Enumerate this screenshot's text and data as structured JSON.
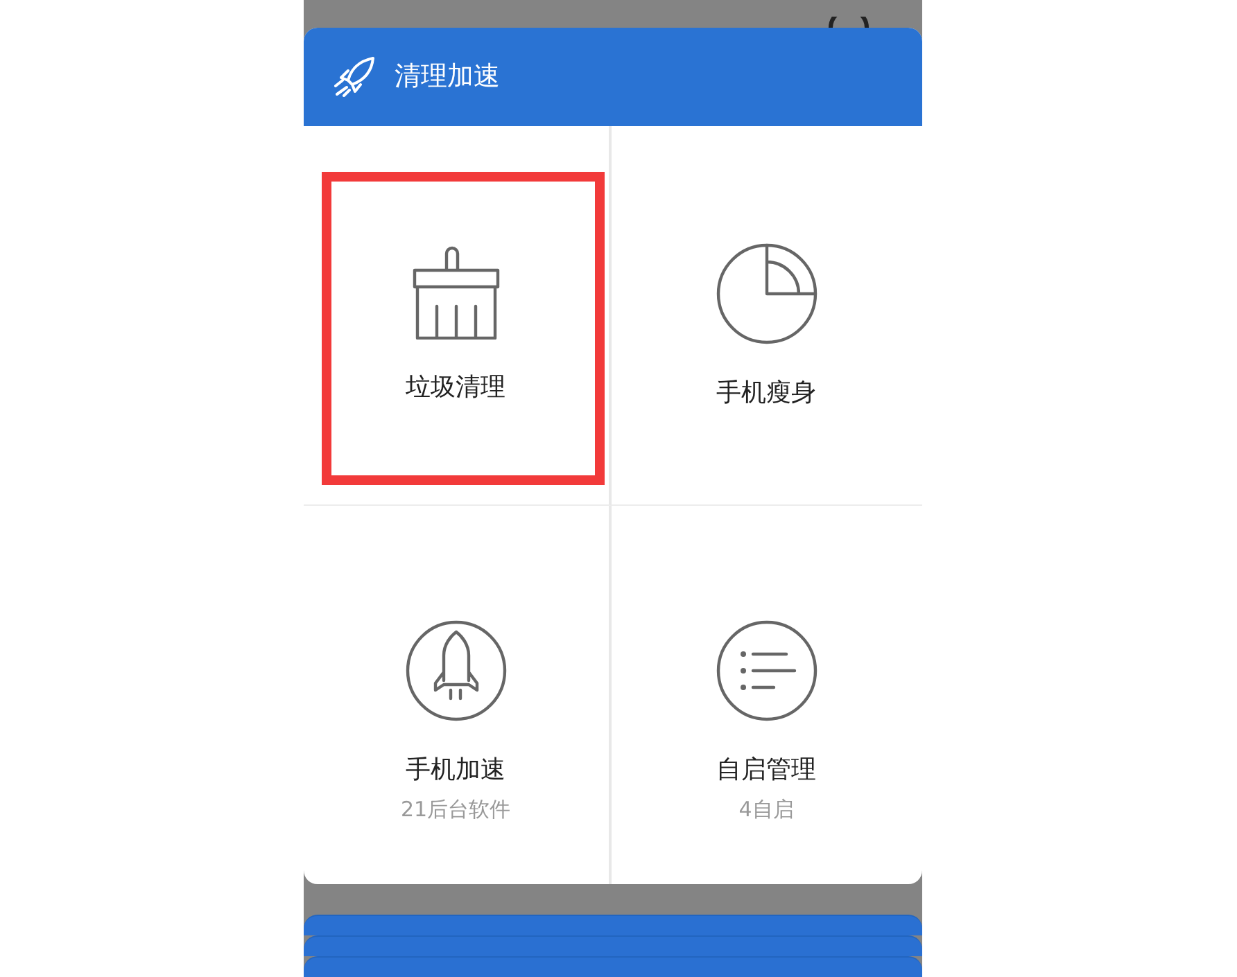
{
  "card": {
    "title": "清理加速"
  },
  "tiles": [
    {
      "kind": "broom",
      "label": "垃圾清理",
      "highlighted": true
    },
    {
      "kind": "pie",
      "label": "手机瘦身",
      "highlighted": false
    },
    {
      "kind": "rocket",
      "label": "手机加速",
      "detail": "21后台软件",
      "highlighted": false
    },
    {
      "kind": "list",
      "label": "自启管理",
      "detail": "4自启",
      "highlighted": false
    }
  ]
}
